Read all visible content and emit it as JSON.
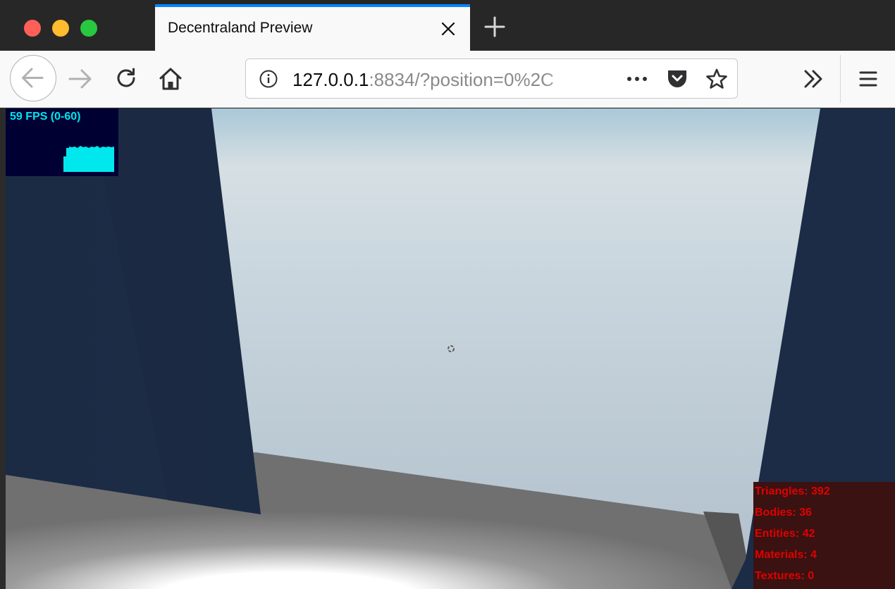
{
  "browser": {
    "tab": {
      "title": "Decentraland Preview"
    },
    "url": {
      "host": "127.0.0.1",
      "rest": ":8834/?position=0%2C"
    }
  },
  "icons": {
    "close": "close-icon",
    "new_tab": "plus-icon",
    "back": "arrow-left-icon",
    "forward": "arrow-right-icon",
    "reload": "reload-icon",
    "home": "home-icon",
    "info": "info-icon",
    "more": "ellipsis-icon",
    "pocket": "pocket-icon",
    "bookmark": "star-icon",
    "overflow": "double-chevron-right-icon",
    "menu": "hamburger-menu-icon"
  },
  "colors": {
    "traffic_red": "#fe5f57",
    "traffic_yellow": "#febc2e",
    "traffic_green": "#28c840",
    "tab_accent": "#0a84ff",
    "fps_text": "#00e5ee",
    "fps_bg": "#000033",
    "stats_text": "#e00000",
    "stats_bg": "#3a1212",
    "wall": "#1b2b44",
    "sky": "#c8d8e0"
  },
  "overlay": {
    "fps": "59 FPS (0-60)",
    "stats": [
      "Triangles: 392",
      "Bodies: 36",
      "Entities: 42",
      "Materials: 4",
      "Textures: 0"
    ]
  }
}
